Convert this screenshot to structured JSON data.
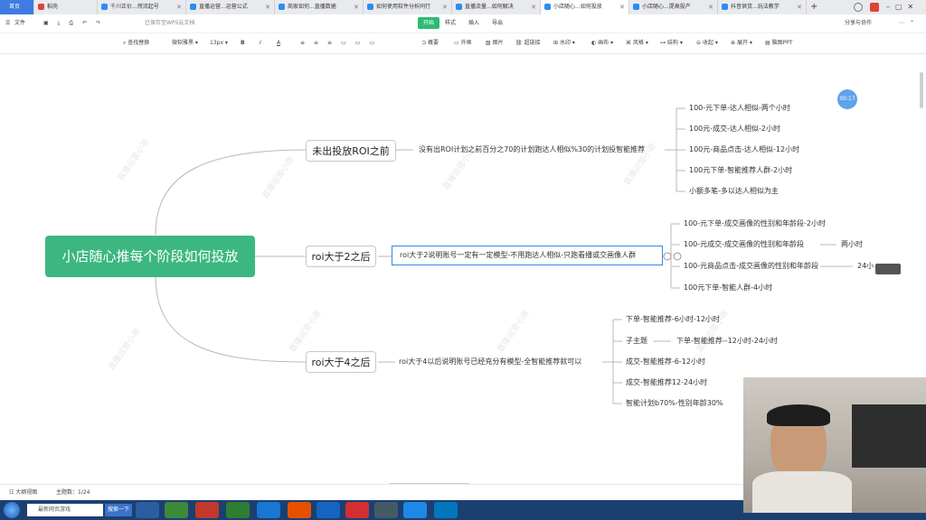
{
  "tabs": [
    {
      "label": "首页"
    },
    {
      "label": "稻壳"
    },
    {
      "label": "千川正价...然流起号"
    },
    {
      "label": "直播运营...运营公式"
    },
    {
      "label": "商家如何...直播数据"
    },
    {
      "label": "如何使用软件分析同行"
    },
    {
      "label": "直播流量...如何解决"
    },
    {
      "label": "小店随心...如何投放"
    },
    {
      "label": "小店随心...提高投产"
    },
    {
      "label": "抖音供货...玩法教学"
    }
  ],
  "tab_new": "+",
  "menubar": {
    "file": "文件",
    "saved": "已保存至WPS云文档",
    "tabs": [
      "开始",
      "样式",
      "插入",
      "导出"
    ],
    "share": "分享与协作"
  },
  "toolbar": {
    "items": [
      "查找替换",
      "微软雅黑",
      "13px",
      "B",
      "I",
      "A",
      "概要",
      "外框",
      "图片",
      "超链接",
      "水印",
      "画布",
      "风格",
      "结构",
      "收起",
      "展开",
      "脑图PPT"
    ]
  },
  "mindmap": {
    "root": "小店随心推每个阶段如何投放",
    "branches": [
      {
        "label": "未出投放ROI之前",
        "desc": "没有出ROI计划之前百分之70的计划跑达人相似%30的计划投智能推荐",
        "children": [
          "100-元下单-达人相似-两个小时",
          "100元-成交-达人相似-2小时",
          "100元-商品点击-达人相似-12小时",
          "100元下单-智能推荐人群-2小时",
          "小额多笔-多以达人相似为主"
        ]
      },
      {
        "label": "roi大于2之后",
        "desc": "roi大于2说明账号一定有一定模型-不用跑达人相似-只跑看播或交画像人群",
        "children": [
          "100-元下单-成交画像的性别和年龄段-2小时",
          "100-元成交-成交画像的性别和年龄段",
          "100-元商品点击-成交画像的性别和年龄段",
          "100元下单-智能人群-4小时"
        ],
        "child_tails": [
          "两小时",
          "24小"
        ]
      },
      {
        "label": "roi大于4之后",
        "desc": "roi大于4以后说明账号已经充分有模型-全智能推荐就可以",
        "children": [
          "下单-智能推荐-6小时-12小时",
          "子主题",
          "成交-智能推荐-6-12小时",
          "成交-智能推荐12-24小时",
          "智能计划b70%-性别年龄30%"
        ],
        "sub_tail": "下单-智能推荐--12小时-24小时"
      }
    ],
    "watermark": "直播运营小哥",
    "timer": "00:17"
  },
  "statusbar": {
    "outline": "大纲视图",
    "topics": "主题数：1/24"
  },
  "taskbar": {
    "start": "开始",
    "search_placeholder": "最新网页游戏",
    "search_btn": "搜索一下"
  },
  "colors": {
    "root": "#3cb782",
    "accent": "#2dbb73",
    "selection": "#3d83e8",
    "taskbar": "#1c3f72"
  }
}
